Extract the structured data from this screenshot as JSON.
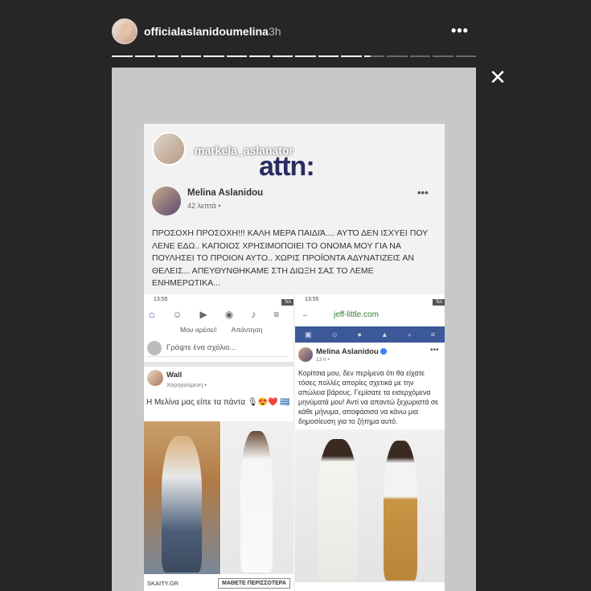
{
  "header": {
    "username": "officialaslanidoumelina",
    "time": "3h",
    "more_icon": "•••",
    "close_icon": "✕"
  },
  "progress": {
    "total_segments": 16,
    "completed_segments": 11,
    "current_segment_fill": 0.3
  },
  "story": {
    "repost_username": "markela_aslanator",
    "brand": "attn:",
    "post": {
      "author": "Melina Aslanidou",
      "time": "42 λεπτά •",
      "more": "•••",
      "text": "ΠΡΟΣΟΧΗ ΠΡΟΣΟΧΗ!!! ΚΑΛΗ ΜΕΡΑ ΠΑΙΔΙΆ.... ΑΥΤΌ ΔΕΝ ΙΣΧΥΕΙ ΠΟΥ ΛΕΝΕ ΕΔΩ.. ΚΑΠΟΙΟΣ ΧΡΗΣΙΜΟΠΟΙΕΙ ΤΟ ΟΝΟΜΑ ΜΟΥ ΓΙΑ ΝΑ ΠΟΥΛΗΣΕΙ ΤΟ ΠΡΟΙΟΝ ΑΥΤΟ.. ΧΩΡΙΣ ΠΡΟΪΟΝΤΑ ΑΔΥΝΑΤΙΖΕΙΣ ΑΝ ΘΕΛΕΙΣ... ΑΠΕΥΘΥΝΘΗΚΑΜΕ ΣΤΗ ΔΙΩΞΗ ΣΑΣ ΤΟ ΛΕΜΕ ΕΝΗΜΕΡΩΤΙΚΑ..."
    },
    "left": {
      "status_time": "13:55",
      "tag": "Τελ",
      "nav_labels": [
        "Μου αρέσει!",
        "Απάντηση"
      ],
      "comment_placeholder": "Γράψτε ένα σχόλιο...",
      "ad_name": "Wall",
      "ad_sub": "Χορηγούμενη •",
      "ad_text": "Η Μελίνα μας είπε τα πάντα 🎙😍❤️ 🇬🇷",
      "source": "SKAITY.GR",
      "cta": "ΜΑΘΕΤΕ ΠΕΡΙΣΣΟΤΕΡΑ"
    },
    "right": {
      "status_time": "13:55",
      "tag": "Τελ",
      "url": "jeff-little.com",
      "author": "Melina Aslanidou",
      "time": "13 h •",
      "more": "•••",
      "text": "Κορίτσια μου, δεν περίμενα ότι θα είχατε τόσες πολλές απορίες σχετικά με την απώλεια βάρους. Γεμίσατε τα εισερχόμενα μηνύματά μου! Αντί να απαντώ ξεχωριστά σε κάθε μήνυμα, αποφάσισα να κάνω μια δημοσίευση για το ζήτημα αυτό."
    }
  }
}
